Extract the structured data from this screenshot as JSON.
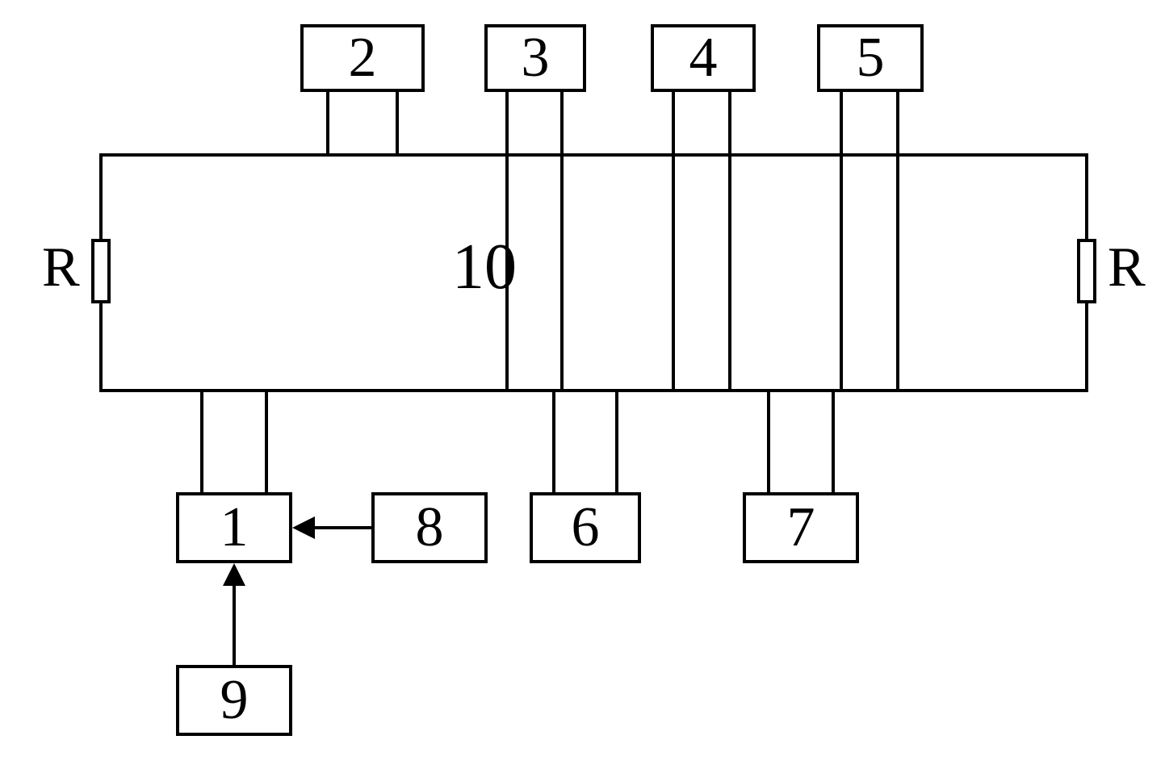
{
  "blocks": {
    "b1": "1",
    "b2": "2",
    "b3": "3",
    "b4": "4",
    "b5": "5",
    "b6": "6",
    "b7": "7",
    "b8": "8",
    "b9": "9",
    "b10": "10"
  },
  "labels": {
    "r_left": "R",
    "r_right": "R"
  }
}
